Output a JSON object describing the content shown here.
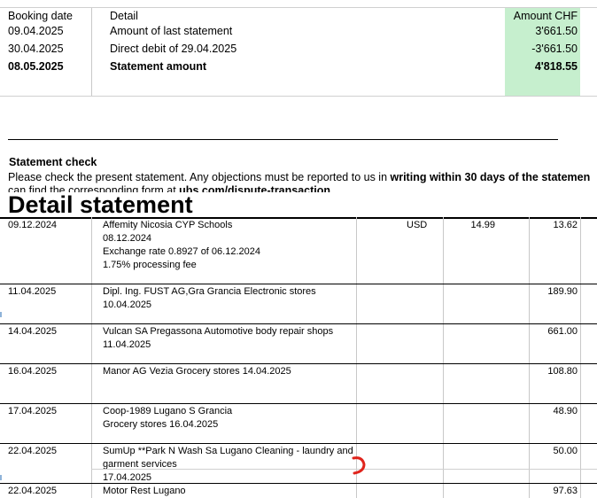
{
  "summary": {
    "headers": {
      "booking_date": "Booking date",
      "detail": "Detail",
      "amount": "Amount CHF"
    },
    "rows": [
      {
        "date": "09.04.2025",
        "detail": "Amount of last statement",
        "amount": "3'661.50",
        "bold": false
      },
      {
        "date": "30.04.2025",
        "detail": "Direct debit of 29.04.2025",
        "amount": "-3'661.50",
        "bold": false
      },
      {
        "date": "08.05.2025",
        "detail": "Statement amount",
        "amount": "4'818.55",
        "bold": true
      }
    ]
  },
  "statement_check": {
    "title": "Statement check",
    "line1_prefix": "Please check the present statement.  Any objections must be reported to  us in ",
    "line1_bold": "writing within 30 days of the statemen",
    "line2_prefix": "can find the corresponding form at ",
    "line2_bold": "ubs.com/dispute-transaction"
  },
  "detail_statement": {
    "title": "Detail statement",
    "transactions": [
      {
        "date": "09.12.2024",
        "lines": [
          "Affemity Nicosia CYP Schools",
          "08.12.2024",
          "Exchange rate 0.8927 of 06.12.2024",
          "1.75% processing  fee"
        ],
        "currency": "USD",
        "foreign_amount": "14.99",
        "amount": "13.62"
      },
      {
        "date": "11.04.2025",
        "lines": [
          "Dipl. Ing. FUST AG,Gra Grancia Electronic stores",
          "10.04.2025"
        ],
        "currency": "",
        "foreign_amount": "",
        "amount": "189.90"
      },
      {
        "date": "14.04.2025",
        "lines": [
          "Vulcan SA Pregassona Automotive  body repair shops",
          "11.04.2025"
        ],
        "currency": "",
        "foreign_amount": "",
        "amount": "661.00"
      },
      {
        "date": "16.04.2025",
        "lines": [
          "Manor AG Vezia Grocery stores 14.04.2025"
        ],
        "currency": "",
        "foreign_amount": "",
        "amount": "108.80"
      },
      {
        "date": "17.04.2025",
        "lines": [
          "Coop-1989 Lugano S Grancia",
          "Grocery stores 16.04.2025"
        ],
        "currency": "",
        "foreign_amount": "",
        "amount": "48.90"
      },
      {
        "date": "22.04.2025",
        "lines": [
          "SumUp  **Park N Wash Sa Lugano Cleaning - laundry and",
          "garment services",
          "17.04.2025"
        ],
        "currency": "",
        "foreign_amount": "",
        "amount": "50.00"
      },
      {
        "date": "22.04.2025",
        "lines": [
          "Motor Rest Lugano"
        ],
        "currency": "",
        "foreign_amount": "",
        "amount": "97.63"
      }
    ]
  },
  "colors": {
    "highlight_green": "#c6efce",
    "annotation_red": "#e0241c"
  }
}
